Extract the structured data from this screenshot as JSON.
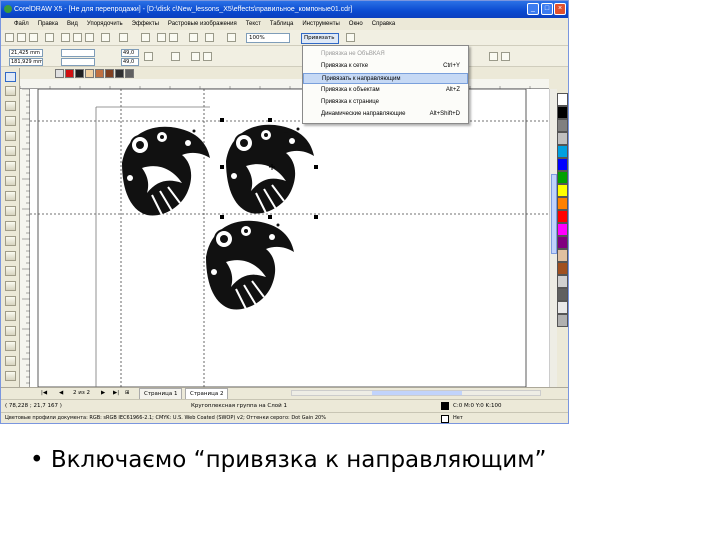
{
  "window": {
    "title": "CorelDRAW X5 - [Не для перепродажи] - [D:\\disk c\\New_lessons_X5\\effects\\правильное_компоные01.cdr]"
  },
  "menu": [
    "Файл",
    "Правка",
    "Вид",
    "Упорядочить",
    "Эффекты",
    "Растровые изображения",
    "Текст",
    "Таблица",
    "Инструменты",
    "Окно",
    "Справка"
  ],
  "toolbar": {
    "zoom_value": "100%",
    "snap_button_label": "Привязать ▾",
    "fields": {
      "x": "21,425 mm",
      "y": "181,929 mm",
      "w": "",
      "h": "",
      "scale_x": "49,0",
      "scale_y": "49,0",
      "pct": "%"
    }
  },
  "snap_menu": [
    {
      "label": "Привязка не ОбъВКАЯ",
      "shortcut": "",
      "state": "disabled"
    },
    {
      "label": "Привязка к сетке",
      "shortcut": "Ctrl+Y",
      "state": "normal"
    },
    {
      "label": "Привязать к направляющим",
      "shortcut": "",
      "state": "highlighted"
    },
    {
      "label": "Привязка к объектам",
      "shortcut": "Alt+Z",
      "state": "normal"
    },
    {
      "label": "Привязка к странице",
      "shortcut": "",
      "state": "normal"
    },
    {
      "label": "Динамические направляющие",
      "shortcut": "Alt+Shift+D",
      "state": "normal"
    }
  ],
  "page_tabs": {
    "counter": "2 из 2",
    "tabs": [
      "Страница 1",
      "Страница 2"
    ]
  },
  "status": {
    "coords": "( 78,228 ; 21,7 167 )",
    "message": "Кругоплексная группа на Слой 1",
    "fill": "C:0 M:0 Y:0 K:100",
    "outline": "Нет",
    "profile": "Цветовые профили документа: RGB: sRGB IEC61966-2.1; CMYK: U.S. Web Coated (SWOP) v2; Оттенки серого: Dot Gain 20%"
  },
  "palette_colors": [
    "#ffffff",
    "#000000",
    "#808080",
    "#c0c0c0",
    "#00a0e0",
    "#0000ff",
    "#00a000",
    "#ffff00",
    "#ff8000",
    "#ff0000",
    "#ff00ff",
    "#800080",
    "#e0c0a0",
    "#a05020",
    "#d0d0d0",
    "#606060",
    "#e8e8e8",
    "#b0b0b0"
  ],
  "swatch_colors": [
    "#e0e0e0",
    "#d01010",
    "#202020",
    "#f0d0a0",
    "#c07040",
    "#804020",
    "#303030",
    "#606060"
  ],
  "caption": "• Включаємо “привязка к направляющим”"
}
